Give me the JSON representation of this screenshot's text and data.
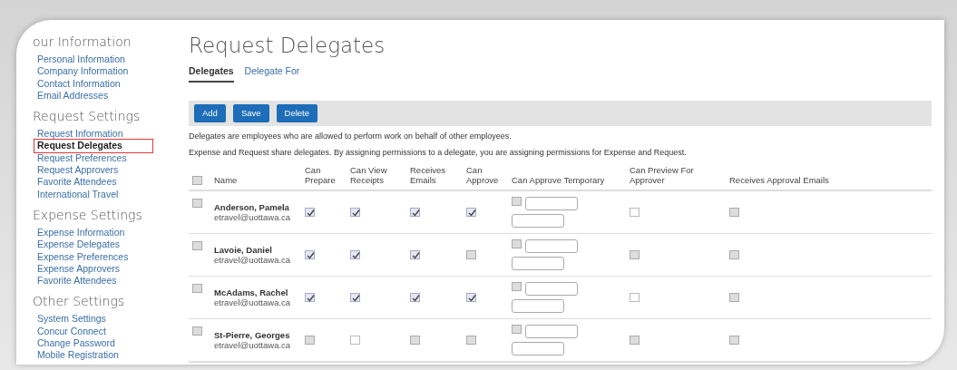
{
  "sidebar": {
    "sections": [
      {
        "heading": "our Information",
        "items": [
          {
            "label": "Personal Information",
            "selected": false
          },
          {
            "label": "Company Information",
            "selected": false
          },
          {
            "label": "Contact Information",
            "selected": false
          },
          {
            "label": "Email Addresses",
            "selected": false
          }
        ]
      },
      {
        "heading": "Request Settings",
        "items": [
          {
            "label": "Request Information",
            "selected": false
          },
          {
            "label": "Request Delegates",
            "selected": true
          },
          {
            "label": "Request Preferences",
            "selected": false
          },
          {
            "label": "Request Approvers",
            "selected": false
          },
          {
            "label": "Favorite Attendees",
            "selected": false
          },
          {
            "label": "International Travel",
            "selected": false
          }
        ]
      },
      {
        "heading": "Expense Settings",
        "items": [
          {
            "label": "Expense Information",
            "selected": false
          },
          {
            "label": "Expense Delegates",
            "selected": false
          },
          {
            "label": "Expense Preferences",
            "selected": false
          },
          {
            "label": "Expense Approvers",
            "selected": false
          },
          {
            "label": "Favorite Attendees",
            "selected": false
          }
        ]
      },
      {
        "heading": "Other Settings",
        "items": [
          {
            "label": "System Settings",
            "selected": false
          },
          {
            "label": "Concur Connect",
            "selected": false
          },
          {
            "label": "Change Password",
            "selected": false
          },
          {
            "label": "Mobile Registration",
            "selected": false
          }
        ]
      }
    ]
  },
  "page_title": "Request Delegates",
  "tabs": [
    {
      "label": "Delegates",
      "selected": true
    },
    {
      "label": "Delegate For",
      "selected": false
    }
  ],
  "toolbar": {
    "buttons": [
      "Add",
      "Save",
      "Delete"
    ]
  },
  "notes": [
    "Delegates are employees who are allowed to perform work on behalf of other employees.",
    "Expense and Request share delegates. By assigning permissions to a delegate, you are assigning permissions for Expense and Request."
  ],
  "table": {
    "select_all": {
      "checked": false
    },
    "columns": [
      "Name",
      "Can Prepare",
      "Can View Receipts",
      "Receives Emails",
      "Can Approve",
      "Can Approve Temporary",
      "Can Preview For Approver",
      "Receives Approval Emails"
    ],
    "rows": [
      {
        "name": "Anderson, Pamela",
        "email": "etravel@uottawa.ca",
        "selected": false,
        "cells": [
          {
            "kind": "checkbox",
            "checked": true,
            "disabled": false
          },
          {
            "kind": "checkbox",
            "checked": true,
            "disabled": false
          },
          {
            "kind": "checkbox",
            "checked": true,
            "disabled": false
          },
          {
            "kind": "checkbox",
            "checked": true,
            "disabled": false
          },
          {
            "kind": "temporary",
            "checked": false,
            "disabled": true
          },
          {
            "kind": "checkbox",
            "checked": false,
            "disabled": false
          },
          {
            "kind": "checkbox",
            "checked": false,
            "disabled": true
          }
        ]
      },
      {
        "name": "Lavoie, Daniel",
        "email": "etravel@uottawa.ca",
        "selected": false,
        "cells": [
          {
            "kind": "checkbox",
            "checked": true,
            "disabled": false
          },
          {
            "kind": "checkbox",
            "checked": true,
            "disabled": false
          },
          {
            "kind": "checkbox",
            "checked": true,
            "disabled": false
          },
          {
            "kind": "checkbox",
            "checked": false,
            "disabled": true
          },
          {
            "kind": "temporary",
            "checked": false,
            "disabled": true
          },
          {
            "kind": "checkbox",
            "checked": false,
            "disabled": true
          },
          {
            "kind": "checkbox",
            "checked": false,
            "disabled": true
          }
        ]
      },
      {
        "name": "McAdams, Rachel",
        "email": "etravel@uottawa.ca",
        "selected": false,
        "cells": [
          {
            "kind": "checkbox",
            "checked": true,
            "disabled": false
          },
          {
            "kind": "checkbox",
            "checked": true,
            "disabled": false
          },
          {
            "kind": "checkbox",
            "checked": true,
            "disabled": false
          },
          {
            "kind": "checkbox",
            "checked": true,
            "disabled": false
          },
          {
            "kind": "temporary",
            "checked": false,
            "disabled": true
          },
          {
            "kind": "checkbox",
            "checked": false,
            "disabled": false
          },
          {
            "kind": "checkbox",
            "checked": false,
            "disabled": true
          }
        ]
      },
      {
        "name": "St-Pierre, Georges",
        "email": "etravel@uottawa.ca",
        "selected": false,
        "cells": [
          {
            "kind": "checkbox",
            "checked": false,
            "disabled": true
          },
          {
            "kind": "checkbox",
            "checked": false,
            "disabled": false
          },
          {
            "kind": "checkbox",
            "checked": false,
            "disabled": true
          },
          {
            "kind": "checkbox",
            "checked": false,
            "disabled": true
          },
          {
            "kind": "temporary",
            "checked": false,
            "disabled": true
          },
          {
            "kind": "checkbox",
            "checked": false,
            "disabled": true
          },
          {
            "kind": "checkbox",
            "checked": false,
            "disabled": true
          }
        ]
      }
    ]
  }
}
